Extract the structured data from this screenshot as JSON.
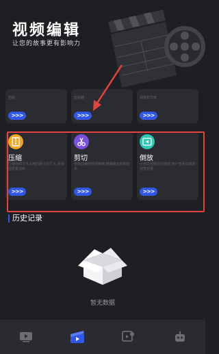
{
  "header": {
    "title": "视频编辑",
    "subtitle": "让您的故事更有影响力"
  },
  "top_row": [
    {
      "desc": "拍摄",
      "button": ">>>"
    },
    {
      "desc": "剪辑器",
      "button": ">>>"
    },
    {
      "desc": "调度和节奏",
      "button": ">>>"
    }
  ],
  "tools": [
    {
      "icon": "zip-file-icon",
      "title": "压缩",
      "desc": "压缩视频文件占用的更小的尺大,并保留质量清晰",
      "button": ">>>",
      "color": "#f2a623"
    },
    {
      "icon": "scissors-icon",
      "title": "剪切",
      "desc": "使用剪裁的特殊精确,精确裁剪的和技术",
      "button": ">>>",
      "color": "#7b4fe0"
    },
    {
      "icon": "rewind-icon",
      "title": "倒放",
      "desc": "让您的视频反向播放,用户查看出现的视觉效果",
      "button": ">>>",
      "color": "#2ec8b4"
    }
  ],
  "history": {
    "title": "历史记录",
    "empty_text": "暂无数据"
  },
  "tabbar": [
    {
      "name": "video-tab-icon"
    },
    {
      "name": "edit-tab-icon",
      "active": true
    },
    {
      "name": "media-tab-icon"
    },
    {
      "name": "robot-tab-icon"
    }
  ],
  "accent": "#3257e6",
  "highlight": "#e5433d"
}
